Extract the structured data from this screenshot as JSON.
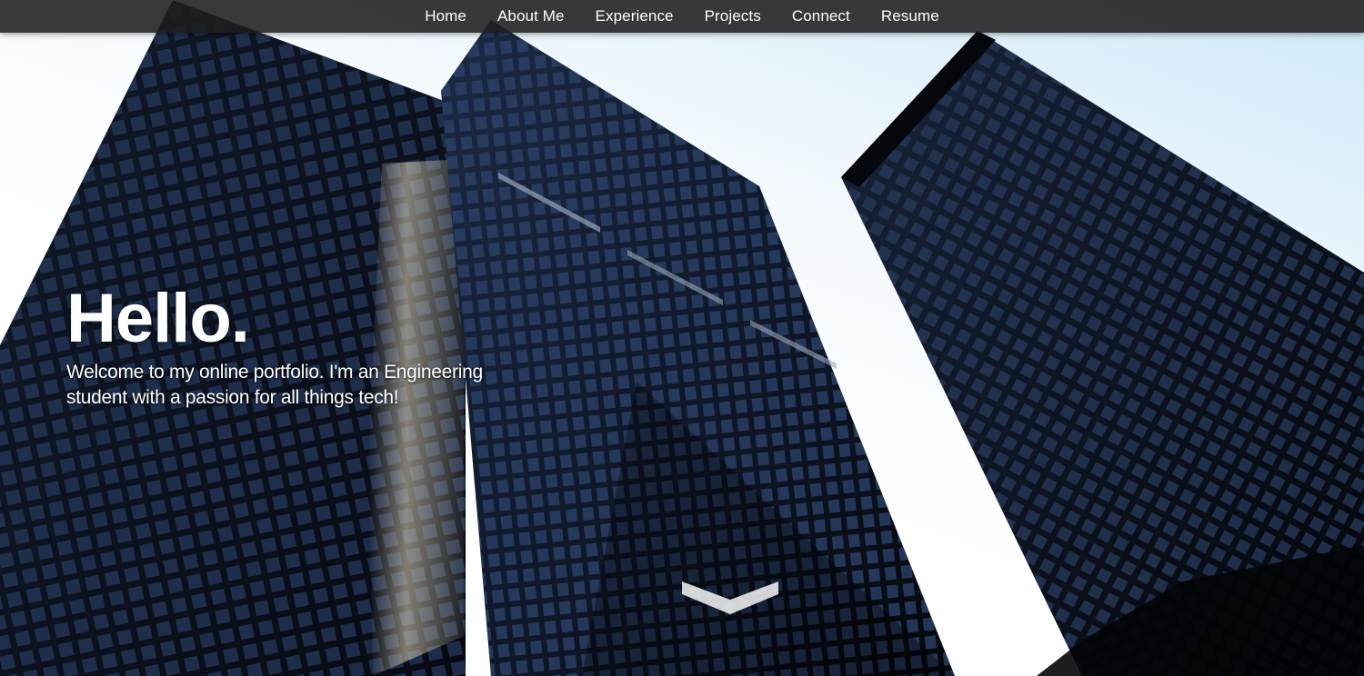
{
  "nav": {
    "items": [
      {
        "label": "Home"
      },
      {
        "label": "About Me"
      },
      {
        "label": "Experience"
      },
      {
        "label": "Projects"
      },
      {
        "label": "Connect"
      },
      {
        "label": "Resume"
      }
    ]
  },
  "hero": {
    "greeting": "Hello.",
    "tagline_line1": "Welcome to my online portfolio. I'm an Engineering",
    "tagline_line2": "student with a passion for all things tech!",
    "scroll_icon": "chevron-down-icon",
    "background_image": "skyscrapers-background"
  },
  "colors": {
    "navbar": "#1e1e1e",
    "text": "#ffffff",
    "sky": "#cfe9f8",
    "building": "#0d1524"
  }
}
